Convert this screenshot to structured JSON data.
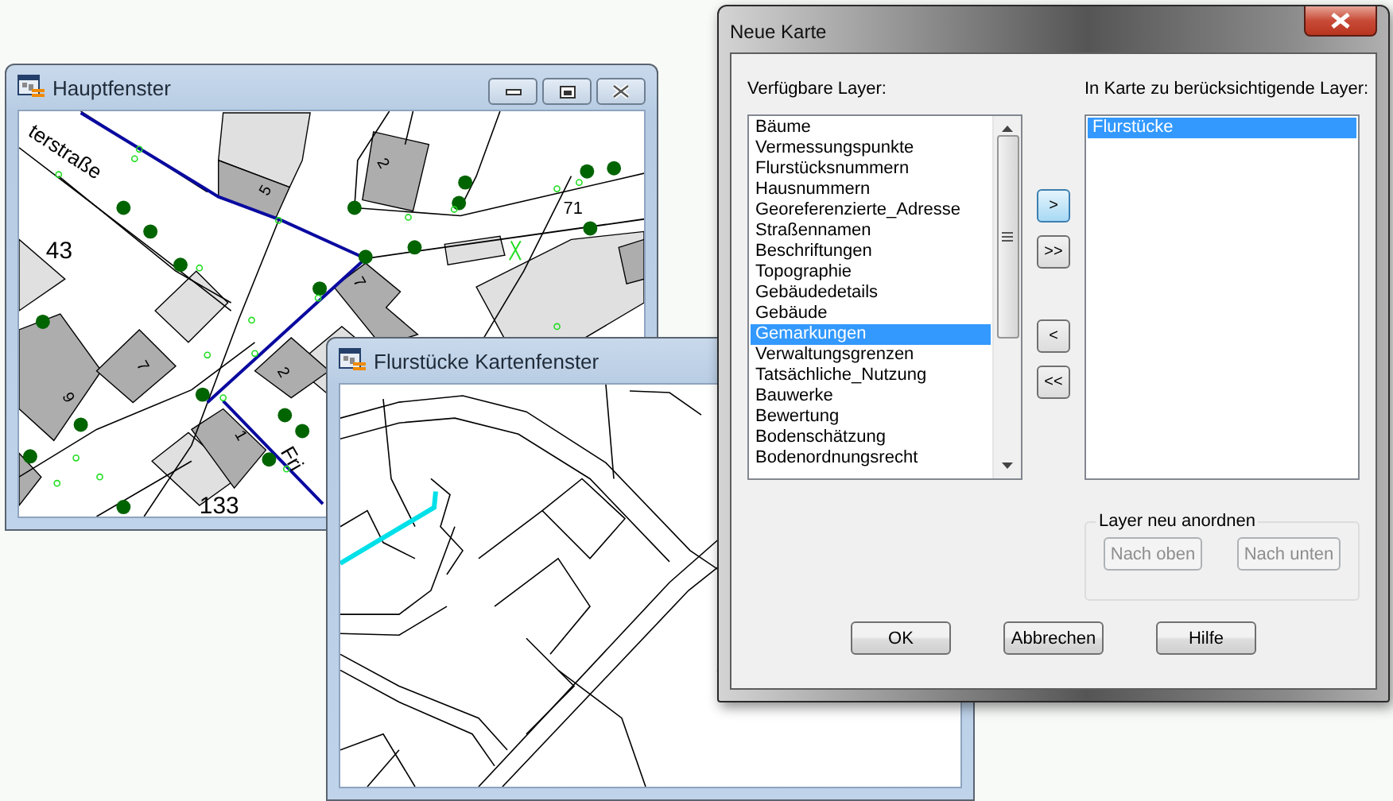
{
  "main_window": {
    "title": "Hauptfenster",
    "map_labels": [
      "terstraße",
      "43",
      "133",
      "71",
      "5",
      "2",
      "7",
      "7",
      "9",
      "2",
      "1",
      "Fri"
    ]
  },
  "map_window": {
    "title": "Flurstücke Kartenfenster"
  },
  "dialog": {
    "title": "Neue Karte",
    "available_label": "Verfügbare Layer:",
    "available_layers": [
      {
        "label": "Bäume",
        "selected": false
      },
      {
        "label": "Vermessungspunkte",
        "selected": false
      },
      {
        "label": "Flurstücksnummern",
        "selected": false
      },
      {
        "label": "Hausnummern",
        "selected": false
      },
      {
        "label": "Georeferenzierte_Adresse",
        "selected": false
      },
      {
        "label": "Straßennamen",
        "selected": false
      },
      {
        "label": "Beschriftungen",
        "selected": false
      },
      {
        "label": "Topographie",
        "selected": false
      },
      {
        "label": "Gebäudedetails",
        "selected": false
      },
      {
        "label": "Gebäude",
        "selected": false
      },
      {
        "label": "Gemarkungen",
        "selected": true
      },
      {
        "label": "Verwaltungsgrenzen",
        "selected": false
      },
      {
        "label": "Tatsächliche_Nutzung",
        "selected": false
      },
      {
        "label": "Bauwerke",
        "selected": false
      },
      {
        "label": "Bewertung",
        "selected": false
      },
      {
        "label": "Bodenschätzung",
        "selected": false
      },
      {
        "label": "Bodenordnungsrecht",
        "selected": false
      }
    ],
    "chosen_label": "In Karte zu berücksichtigende Layer:",
    "chosen_layers": [
      {
        "label": "Flurstücke",
        "selected": true
      }
    ],
    "move_buttons": [
      {
        "label": ">",
        "focused": true
      },
      {
        "label": ">>",
        "focused": false
      },
      {
        "label": "<",
        "focused": false
      },
      {
        "label": "<<",
        "focused": false
      }
    ],
    "reorder_group": {
      "title": "Layer neu anordnen",
      "buttons": [
        {
          "label": "Nach oben",
          "disabled": true
        },
        {
          "label": "Nach unten",
          "disabled": true
        }
      ]
    },
    "buttons": [
      "OK",
      "Abbrechen",
      "Hilfe"
    ]
  }
}
